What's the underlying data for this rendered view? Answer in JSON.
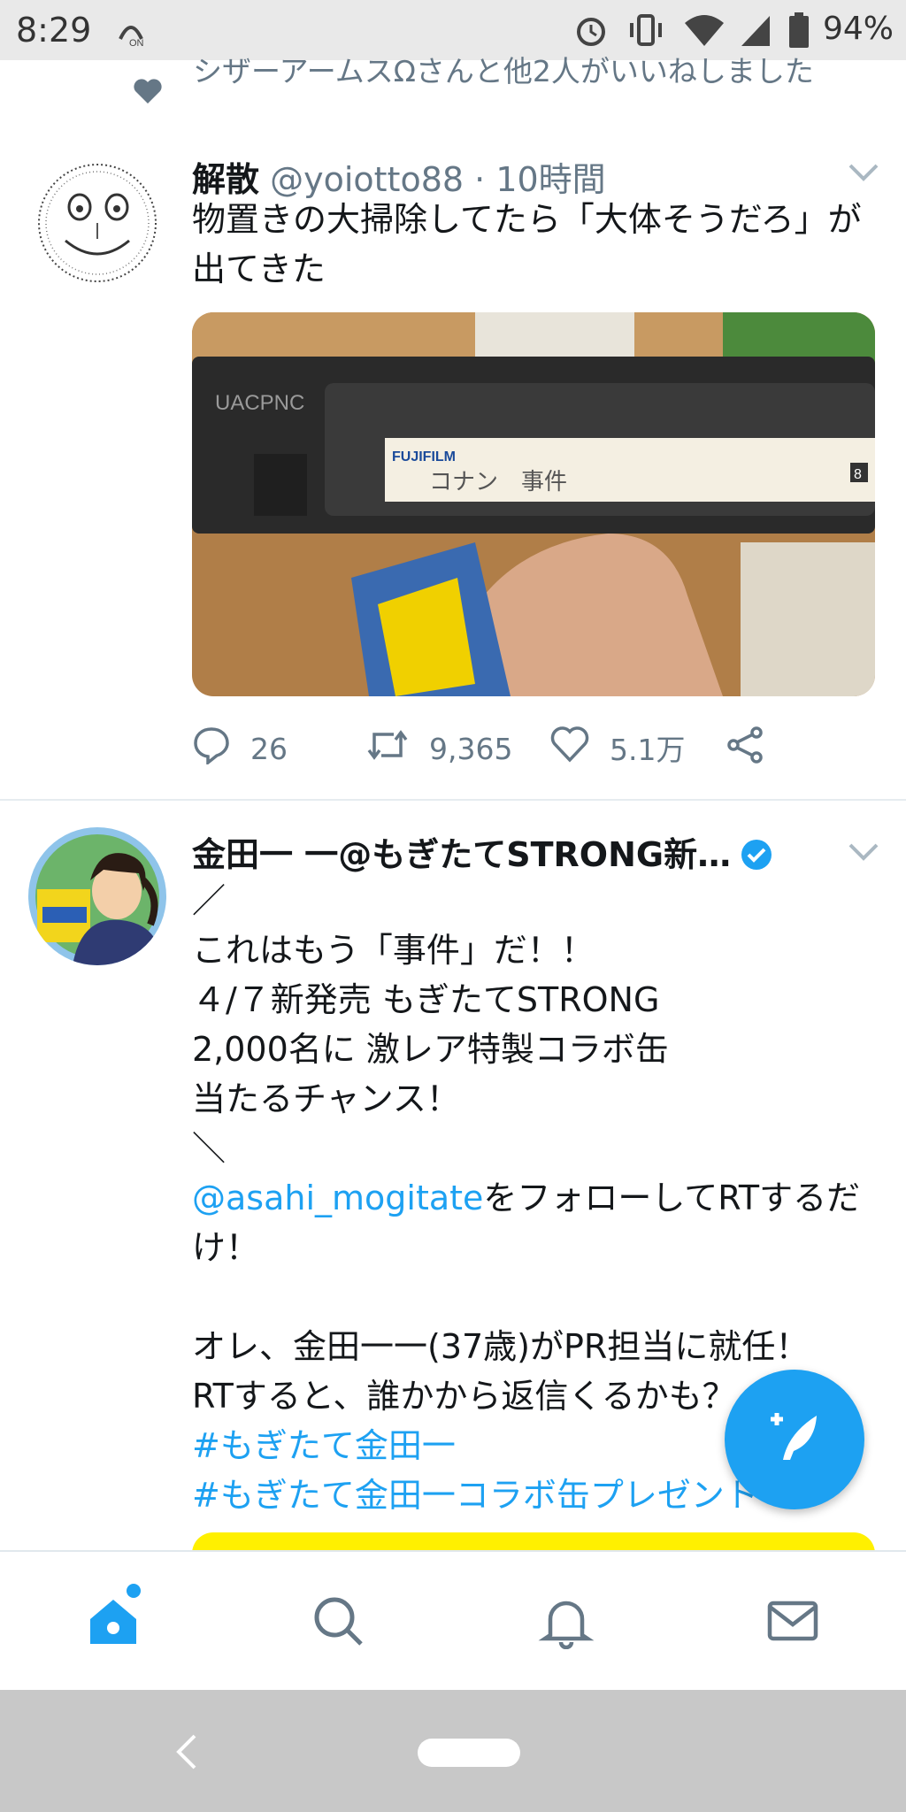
{
  "status_bar": {
    "time": "8:29",
    "battery": "94%"
  },
  "like_context": {
    "text": "シザーアームスΩさんと他2人がいいねしました"
  },
  "tweets": [
    {
      "display_name": "解散",
      "handle": "@yoiotto88",
      "separator": " · ",
      "time": "10時間",
      "text": "物置きの大掃除してたら「大体そうだろ」が出てきた",
      "media": {
        "label_brand": "FUJIFILM",
        "label_handwriting": "コナン　事件",
        "label_code": "8",
        "tape_side_text": "UACPNC"
      },
      "actions": {
        "replies": "26",
        "retweets": "9,365",
        "likes": "5.1万"
      }
    },
    {
      "display_name": "金田一 一@もぎたてSTRONG新…",
      "text_line1": "／\nこれはもう「事件」だ！！\n４/７新発売 もぎたてSTRONG\n2,000名に 激レア特製コラボ缶\n当たるチャンス！\n＼\n",
      "mention": "@asahi_mogitate",
      "text_line2": "をフォローしてRTするだけ！\n\nオレ、金田一一(37歳)がPR担当に就任！\nRTすると、誰かから返信くるかも？\n",
      "hashtag1": "#もぎたて金田一",
      "hashtag2": "#もぎたて金田一コラボ缶プレゼント"
    }
  ],
  "colors": {
    "accent": "#1da1f2",
    "secondary_text": "#657786",
    "promo_card": "#fff000"
  },
  "icons": {
    "home": "home-icon",
    "search": "search-icon",
    "notifications": "bell-icon",
    "messages": "mail-icon",
    "compose": "compose-tweet-icon"
  }
}
